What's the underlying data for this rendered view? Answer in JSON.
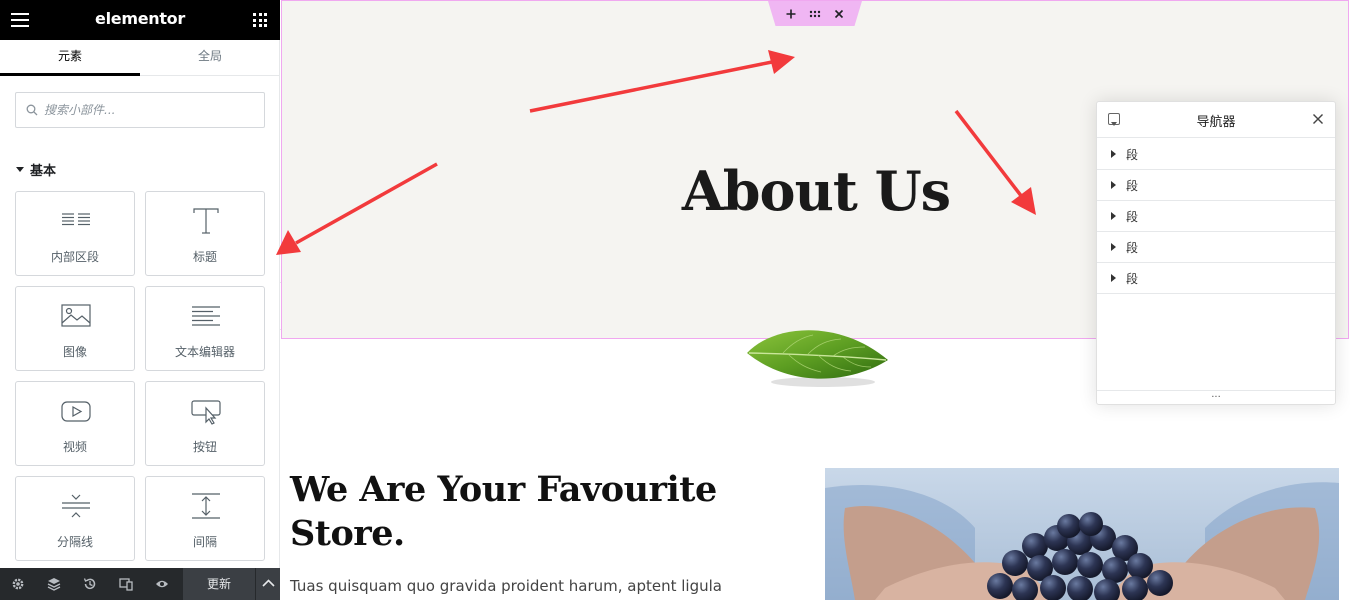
{
  "header": {
    "brand": "elementor",
    "menu_icon": "hamburger-icon",
    "apps_icon": "grid-icon"
  },
  "tabs": [
    {
      "label": "元素",
      "active": true
    },
    {
      "label": "全局",
      "active": false
    }
  ],
  "search": {
    "placeholder": "搜索小部件...",
    "value": ""
  },
  "category": {
    "title": "基本"
  },
  "widgets": [
    {
      "label": "内部区段",
      "icon": "inner-section-icon"
    },
    {
      "label": "标题",
      "icon": "heading-icon"
    },
    {
      "label": "图像",
      "icon": "image-icon"
    },
    {
      "label": "文本编辑器",
      "icon": "text-editor-icon"
    },
    {
      "label": "视频",
      "icon": "video-icon"
    },
    {
      "label": "按钮",
      "icon": "button-icon"
    },
    {
      "label": "分隔线",
      "icon": "divider-icon"
    },
    {
      "label": "间隔",
      "icon": "spacer-icon"
    }
  ],
  "footer": {
    "update_label": "更新"
  },
  "canvas": {
    "hero_title": "About Us",
    "heading": "We Are Your Favourite Store.",
    "text": "Tuas quisquam quo gravida proident harum, aptent ligula"
  },
  "navigator": {
    "title": "导航器",
    "items": [
      {
        "label": "段"
      },
      {
        "label": "段"
      },
      {
        "label": "段"
      },
      {
        "label": "段"
      },
      {
        "label": "段"
      }
    ],
    "resize_handle": "..."
  },
  "colors": {
    "panel_header": "#000000",
    "section_highlight": "#f0b6f3",
    "hero_bg": "#f5f4f1",
    "annotation_arrow": "#f23a3c"
  }
}
